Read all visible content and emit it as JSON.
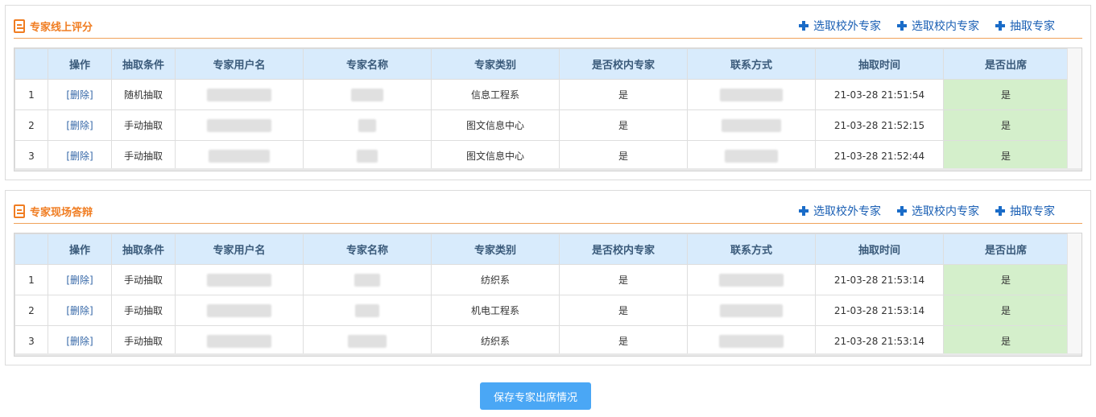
{
  "sections": [
    {
      "title": "专家线上评分",
      "actions": [
        "选取校外专家",
        "选取校内专家",
        "抽取专家"
      ],
      "rows": [
        {
          "no": "1",
          "op": "[删除]",
          "condition": "随机抽取",
          "category": "信息工程系",
          "internal": "是",
          "time": "21-03-28 21:51:54",
          "attend": "是"
        },
        {
          "no": "2",
          "op": "[删除]",
          "condition": "手动抽取",
          "category": "图文信息中心",
          "internal": "是",
          "time": "21-03-28 21:52:15",
          "attend": "是"
        },
        {
          "no": "3",
          "op": "[删除]",
          "condition": "手动抽取",
          "category": "图文信息中心",
          "internal": "是",
          "time": "21-03-28 21:52:44",
          "attend": "是"
        }
      ]
    },
    {
      "title": "专家现场答辩",
      "actions": [
        "选取校外专家",
        "选取校内专家",
        "抽取专家"
      ],
      "rows": [
        {
          "no": "1",
          "op": "[删除]",
          "condition": "手动抽取",
          "category": "纺织系",
          "internal": "是",
          "time": "21-03-28 21:53:14",
          "attend": "是"
        },
        {
          "no": "2",
          "op": "[删除]",
          "condition": "手动抽取",
          "category": "机电工程系",
          "internal": "是",
          "time": "21-03-28 21:53:14",
          "attend": "是"
        },
        {
          "no": "3",
          "op": "[删除]",
          "condition": "手动抽取",
          "category": "纺织系",
          "internal": "是",
          "time": "21-03-28 21:53:14",
          "attend": "是"
        }
      ]
    }
  ],
  "columns": [
    "",
    "操作",
    "抽取条件",
    "专家用户名",
    "专家名称",
    "专家类别",
    "是否校内专家",
    "联系方式",
    "抽取时间",
    "是否出席"
  ],
  "save_label": "保存专家出席情况",
  "colors": {
    "accent": "#f07d22",
    "link": "#1a5fb4",
    "header_bg": "#d8ebfc",
    "attend_bg": "#d4efcb",
    "button": "#4aa7f5"
  }
}
